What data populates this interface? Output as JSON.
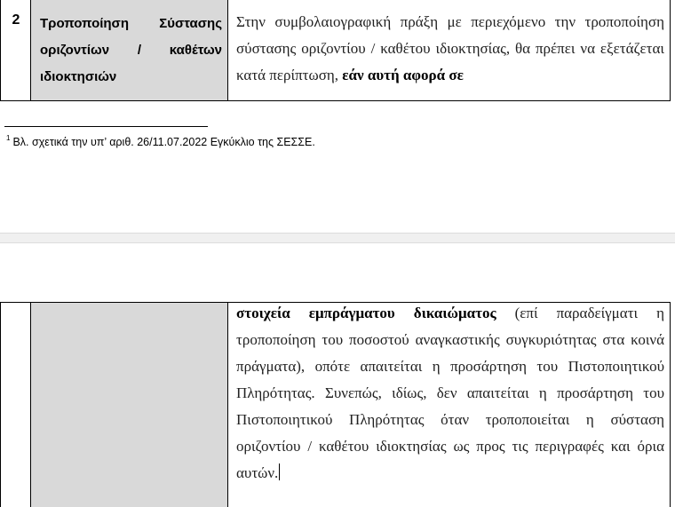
{
  "row_top": {
    "number": "2",
    "title": "Τροποποίηση Σύστασης οριζοντίων / καθέτων ιδιοκτησιών",
    "body_plain": "Στην συμβολαιογραφική πράξη με περιεχόμενο την τροποποίηση σύστασης οριζοντίου / καθέτου ιδιοκτησίας, θα πρέπει να εξετάζεται κατά περίπτωση, ",
    "body_bold": "εάν αυτή αφορά σε"
  },
  "footnote": {
    "marker": "1",
    "text": "Βλ. σχετικά την υπ’ αριθ. 26/11.07.2022 Εγκύκλιο της ΣΕΣΣΕ."
  },
  "row_bottom": {
    "body_bold": "στοιχεία εμπράγματου δικαιώματος",
    "body_plain": " (επί παραδείγματι η τροποποίηση του ποσοστού αναγκαστικής συγκυριότητας στα κοινά πράγματα), οπότε απαιτείται η προσάρτηση του Πιστοποιητικού Πληρότητας. Συνεπώς, ιδίως, δεν απαιτείται η προσάρτηση του Πιστοποιητικού Πληρότητας όταν τροποποιείται η σύσταση οριζοντίου / καθέτου ιδιοκτησίας ως προς τις περιγραφές και όρια αυτών."
  },
  "colors": {
    "title_cell_bg": "#d9d9d9",
    "page_gap": "#f0f0f0"
  }
}
